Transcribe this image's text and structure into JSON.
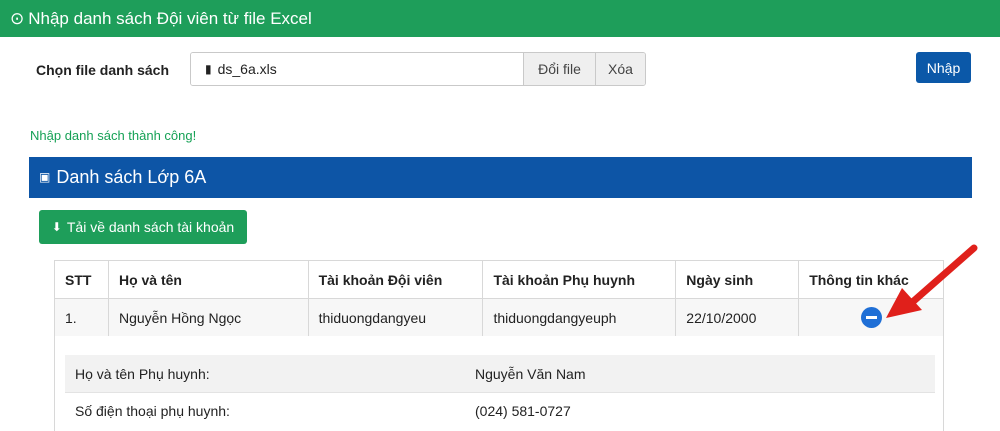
{
  "header": {
    "title": "Nhập danh sách Đội viên từ file Excel",
    "icon": "clock-icon"
  },
  "file_picker": {
    "label": "Chọn file danh sách",
    "file_name": "ds_6a.xls",
    "change_label": "Đổi file",
    "delete_label": "Xóa"
  },
  "import_button": "Nhập",
  "success_message": "Nhập danh sách thành công!",
  "panel": {
    "title": "Danh sách Lớp 6A",
    "icon": "id-card-icon"
  },
  "download_button": "Tải về danh sách tài khoản",
  "table": {
    "headers": [
      "STT",
      "Họ và tên",
      "Tài khoản Đội viên",
      "Tài khoản Phụ huynh",
      "Ngày sinh",
      "Thông tin khác"
    ],
    "rows": [
      [
        "1.",
        "Nguyễn Hồng Ngọc",
        "thiduongdangyeu",
        "thiduongdangyeuph",
        "22/10/2000"
      ]
    ]
  },
  "details": [
    {
      "label": "Họ và tên Phụ huynh:",
      "value": "Nguyễn Văn Nam"
    },
    {
      "label": "Số điện thoại phụ huynh:",
      "value": "(024) 581-0727"
    }
  ],
  "colors": {
    "green": "#1e9e5a",
    "blue": "#0d55a6",
    "button_blue": "#0b58a8",
    "arrow_red": "#e0201b"
  }
}
